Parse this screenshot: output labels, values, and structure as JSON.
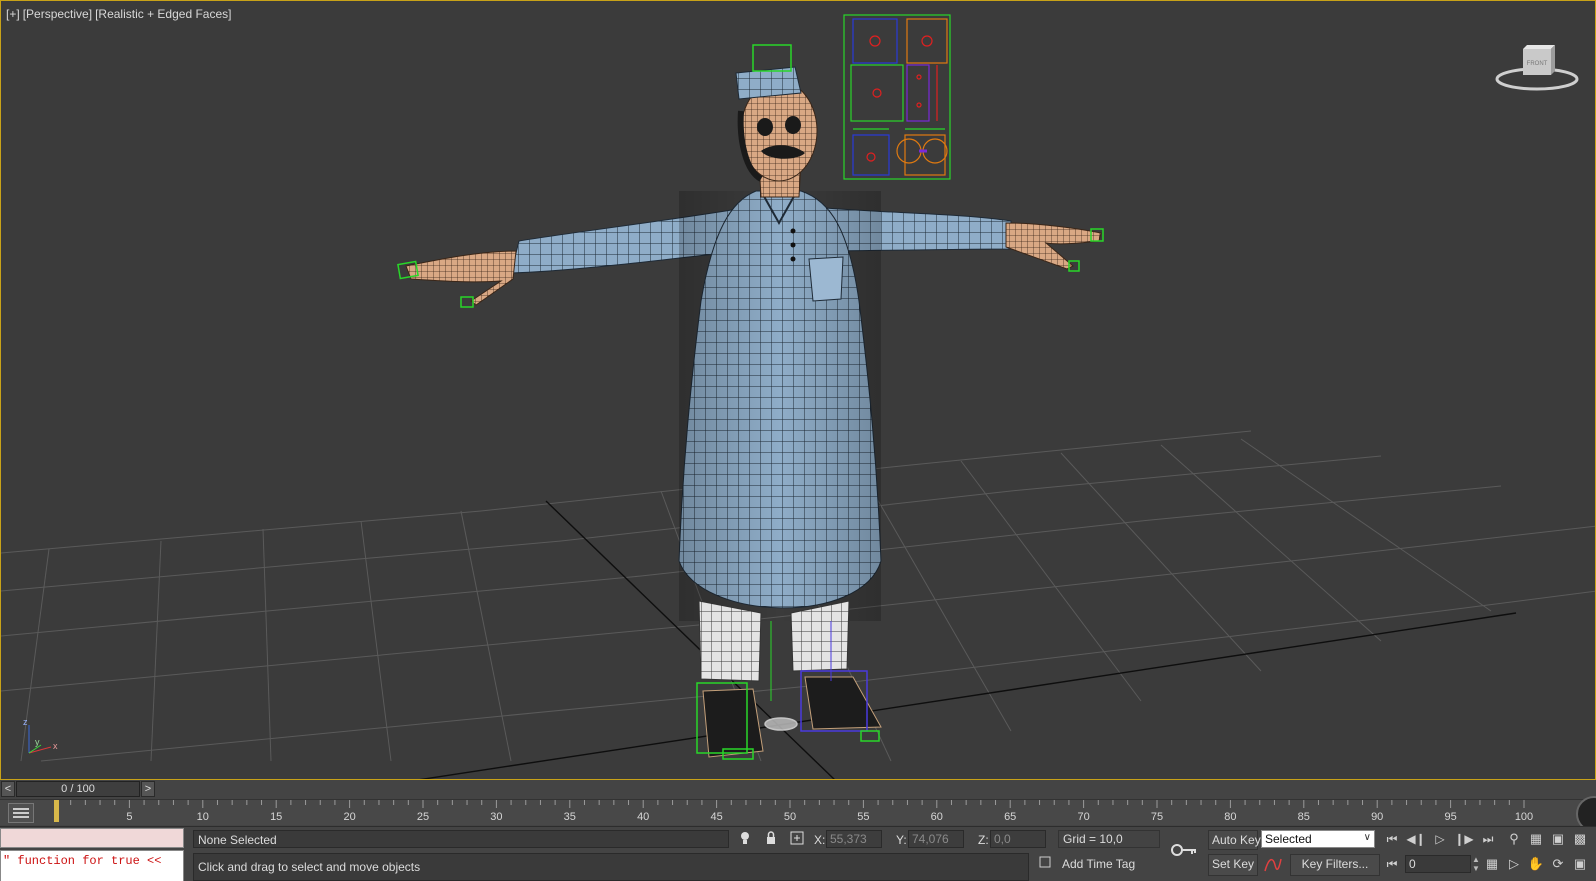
{
  "viewport": {
    "label_plus": "[+]",
    "label_view": "[Perspective]",
    "label_shading": "[Realistic + Edged Faces]",
    "viewcube_label": "FRONT",
    "axis_z": "z",
    "axis_y": "y",
    "axis_x": "x",
    "border_color": "#c8a218"
  },
  "time_slider": {
    "left_arrow": "<",
    "right_arrow": ">",
    "thumb_label": "0 / 100"
  },
  "track_bar": {
    "ticks": [
      "5",
      "10",
      "15",
      "20",
      "25",
      "30",
      "35",
      "40",
      "45",
      "50",
      "55",
      "60",
      "65",
      "70",
      "75",
      "80",
      "85",
      "90",
      "95",
      "100"
    ],
    "current_frame": 0
  },
  "script": {
    "listener_output": "\" function for true <<"
  },
  "status": {
    "selection": "None Selected",
    "prompt": "Click and drag to select and move objects",
    "x_label": "X:",
    "x_value": "55,373",
    "y_label": "Y:",
    "y_value": "74,076",
    "z_label": "Z:",
    "z_value": "0,0",
    "grid": "Grid = 10,0",
    "add_time_tag": "Add Time Tag"
  },
  "animation": {
    "auto_key": "Auto Key",
    "set_key": "Set Key",
    "selection_set": "Selected",
    "key_filters": "Key Filters...",
    "current_frame": "0"
  }
}
